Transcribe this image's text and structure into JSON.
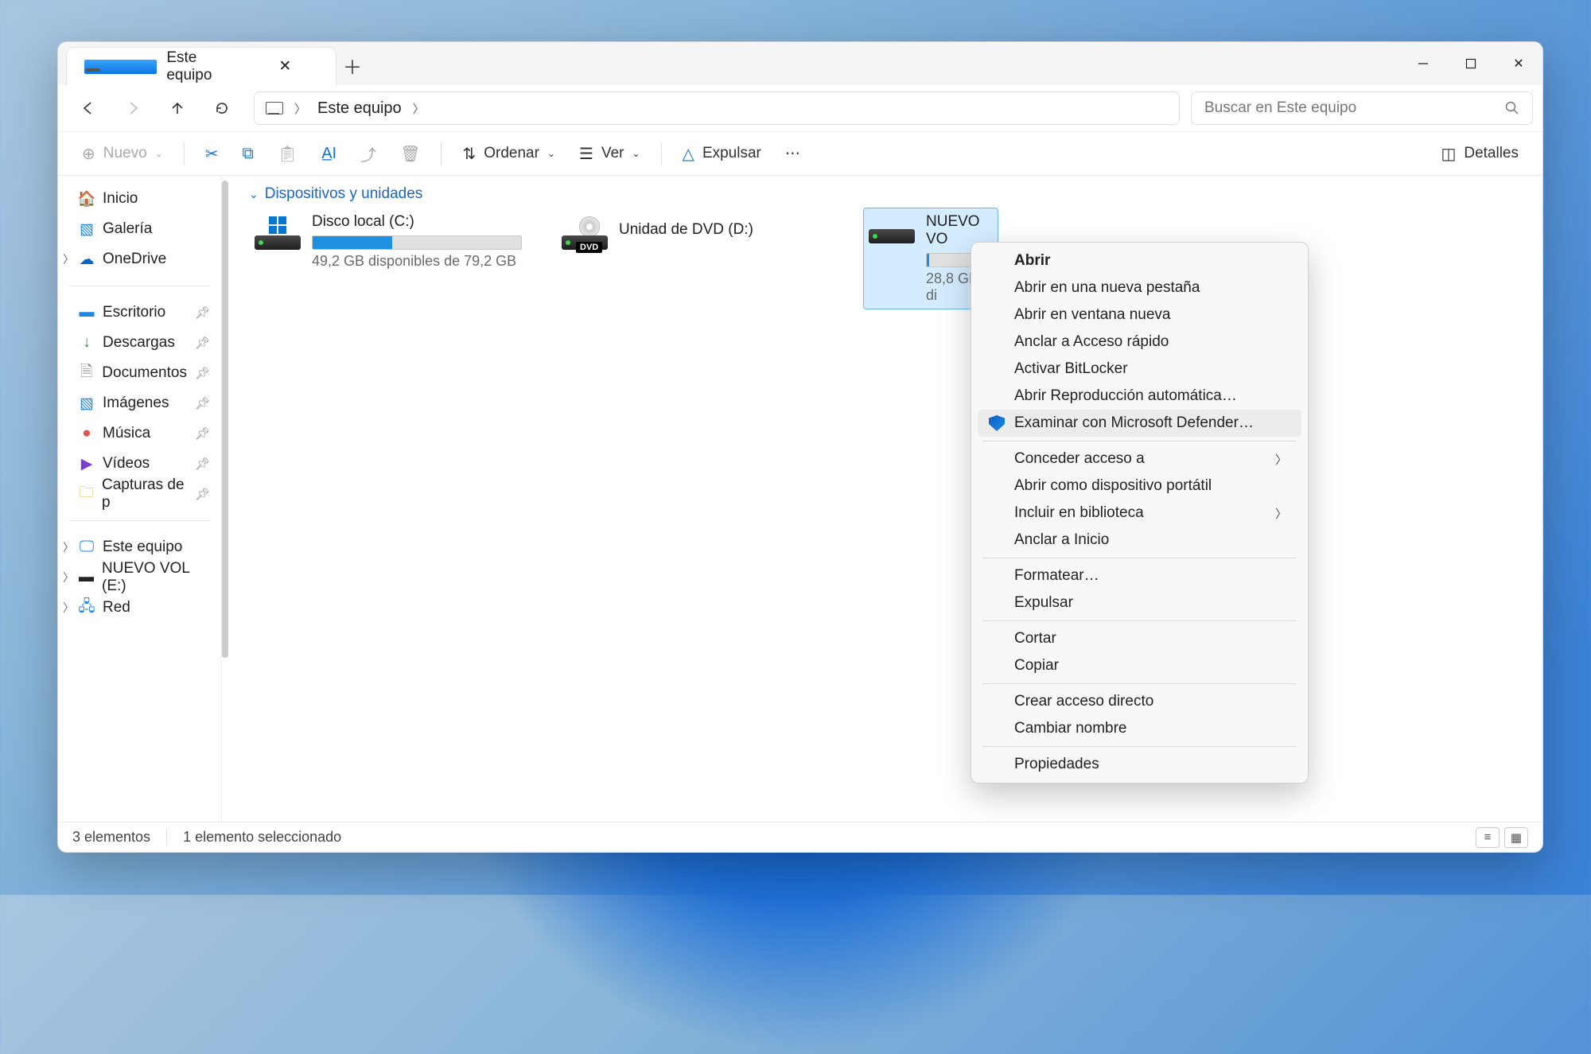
{
  "tab": {
    "title": "Este equipo"
  },
  "breadcrumb": {
    "location": "Este equipo"
  },
  "search": {
    "placeholder": "Buscar en Este equipo"
  },
  "toolbar": {
    "new": "Nuevo",
    "sort": "Ordenar",
    "view": "Ver",
    "eject": "Expulsar",
    "details": "Detalles"
  },
  "sidebar": {
    "home": "Inicio",
    "gallery": "Galería",
    "onedrive": "OneDrive",
    "desktop": "Escritorio",
    "downloads": "Descargas",
    "documents": "Documentos",
    "pictures": "Imágenes",
    "music": "Música",
    "videos": "Vídeos",
    "captures": "Capturas de p",
    "this_pc": "Este equipo",
    "new_vol": "NUEVO VOL (E:)",
    "network": "Red"
  },
  "group": {
    "label": "Dispositivos y unidades"
  },
  "devices": {
    "c": {
      "title": "Disco local (C:)",
      "sub": "49,2 GB disponibles de 79,2 GB",
      "fill": 38
    },
    "d": {
      "title": "Unidad de DVD (D:)"
    },
    "e": {
      "title": "NUEVO VO",
      "sub": "28,8 GB di",
      "fill": 4
    }
  },
  "context_menu": {
    "open": "Abrir",
    "open_new_tab": "Abrir en una nueva pestaña",
    "open_new_window": "Abrir en ventana nueva",
    "pin_quick": "Anclar a Acceso rápido",
    "bitlocker": "Activar BitLocker",
    "autoplay": "Abrir Reproducción automática…",
    "defender": "Examinar con Microsoft Defender…",
    "access": "Conceder acceso a",
    "portable": "Abrir como dispositivo portátil",
    "library": "Incluir en biblioteca",
    "pin_start": "Anclar a Inicio",
    "format": "Formatear…",
    "eject": "Expulsar",
    "cut": "Cortar",
    "copy": "Copiar",
    "shortcut": "Crear acceso directo",
    "rename": "Cambiar nombre",
    "properties": "Propiedades"
  },
  "status": {
    "count": "3 elementos",
    "selected": "1 elemento seleccionado"
  }
}
